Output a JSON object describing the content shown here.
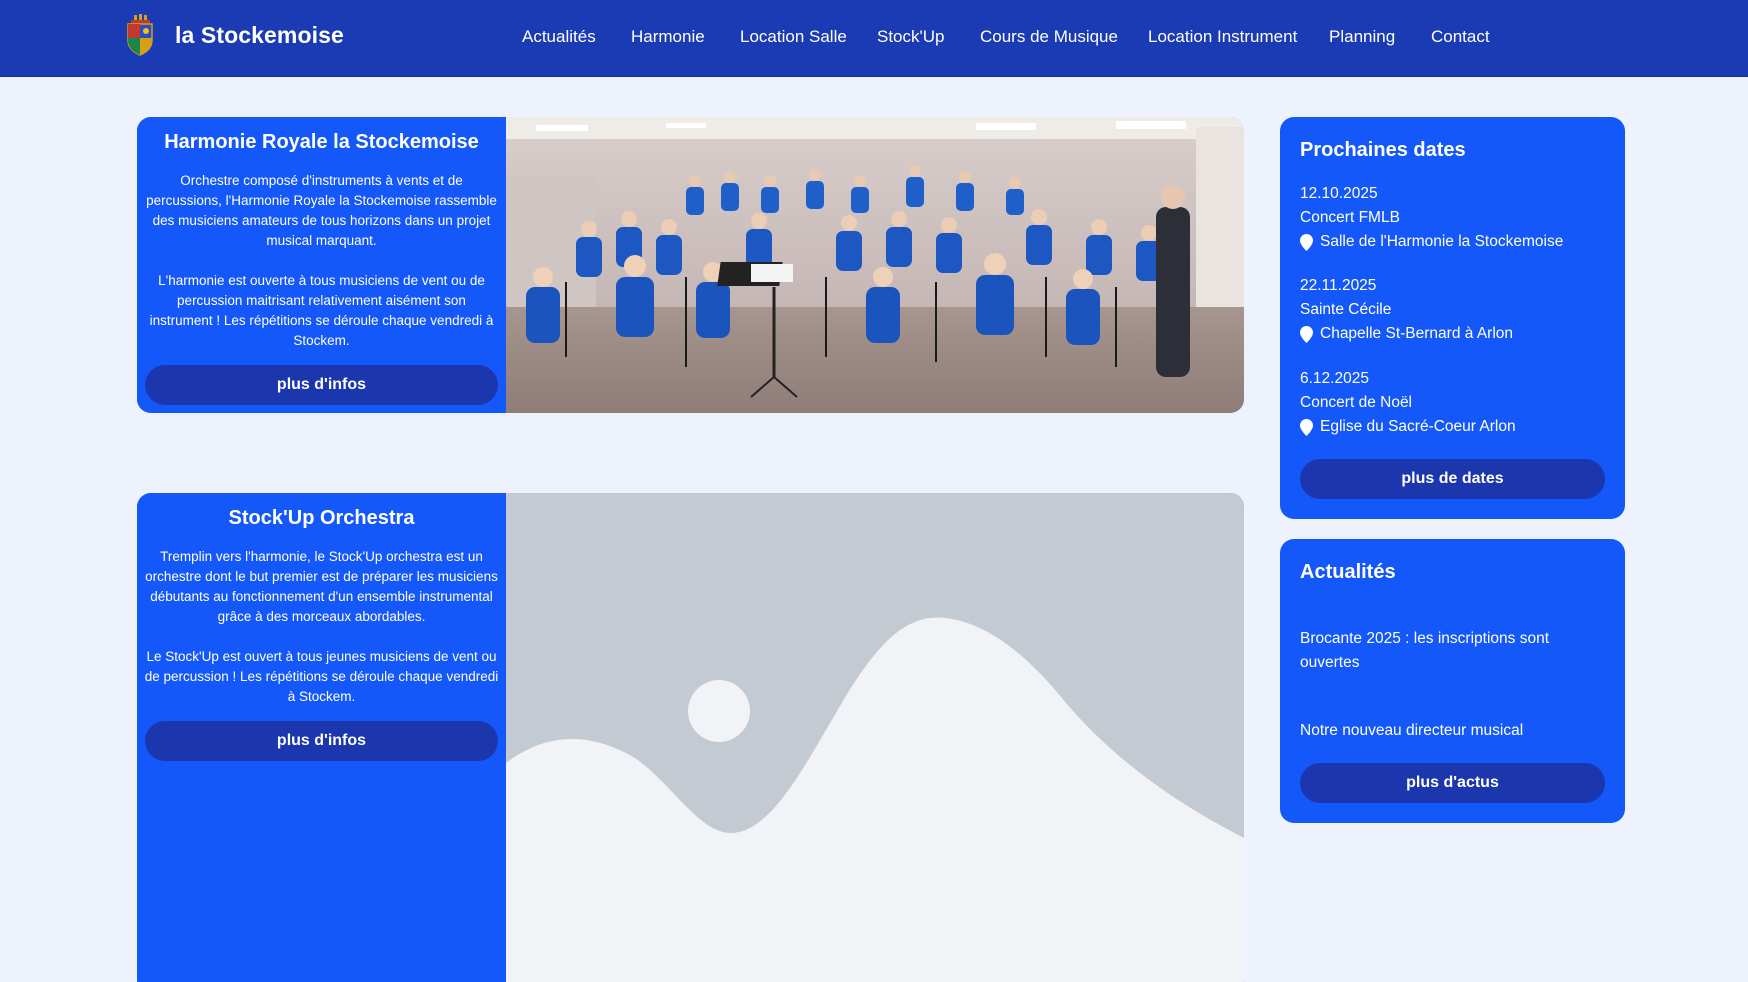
{
  "header": {
    "brand": "la Stockemoise",
    "logo_icon": "crest-icon",
    "nav": [
      {
        "label": "Actualités"
      },
      {
        "label": "Harmonie"
      },
      {
        "label": "Location Salle"
      },
      {
        "label": "Stock'Up"
      },
      {
        "label": "Cours de Musique"
      },
      {
        "label": "Location Instrument"
      },
      {
        "label": "Planning"
      },
      {
        "label": "Contact"
      }
    ]
  },
  "main": {
    "cards": [
      {
        "title": "Harmonie Royale la Stockemoise",
        "paragraphs": [
          "Orchestre composé d'instruments à vents et de percussions, l'Harmonie Royale la Stockemoise rassemble des musiciens amateurs de tous horizons dans un projet musical marquant.",
          "L'harmonie est ouverte à tous musiciens de vent ou de percussion maitrisant relativement aisément son instrument ! Les répétitions se déroule chaque vendredi à Stockem."
        ],
        "button": "plus d'infos",
        "image": "orchestra-photo"
      },
      {
        "title": "Stock'Up Orchestra",
        "paragraphs": [
          "Tremplin vers l'harmonie, le Stock'Up orchestra est un orchestre dont le but premier est de préparer les musiciens débutants au fonctionnement d'un ensemble instrumental grâce à des morceaux abordables.",
          "Le Stock'Up est ouvert à tous jeunes musiciens de vent ou de percussion ! Les répétitions se déroule chaque vendredi à Stockem."
        ],
        "button": "plus d'infos",
        "image": "image-placeholder"
      }
    ]
  },
  "sidebar": {
    "dates": {
      "title": "Prochaines dates",
      "events": [
        {
          "date": "12.10.2025",
          "name": "Concert FMLB",
          "location": "Salle de l'Harmonie la Stockemoise"
        },
        {
          "date": "22.11.2025",
          "name": "Sainte Cécile",
          "location": "Chapelle St-Bernard à Arlon"
        },
        {
          "date": "6.12.2025",
          "name": "Concert de Noël",
          "location": "Eglise du Sacré-Coeur Arlon"
        }
      ],
      "button": "plus de dates"
    },
    "news": {
      "title": "Actualités",
      "items": [
        {
          "label": "Brocante 2025 : les inscriptions sont ouvertes"
        },
        {
          "label": "Notre nouveau directeur musical"
        }
      ],
      "button": "plus d'actus"
    }
  },
  "colors": {
    "header": "#1a3bb3",
    "card": "#1458fa",
    "button": "#1c37ad",
    "background": "#eef2fd",
    "placeholder_back": "#c4cad2",
    "placeholder_front": "#f1f3f6"
  }
}
